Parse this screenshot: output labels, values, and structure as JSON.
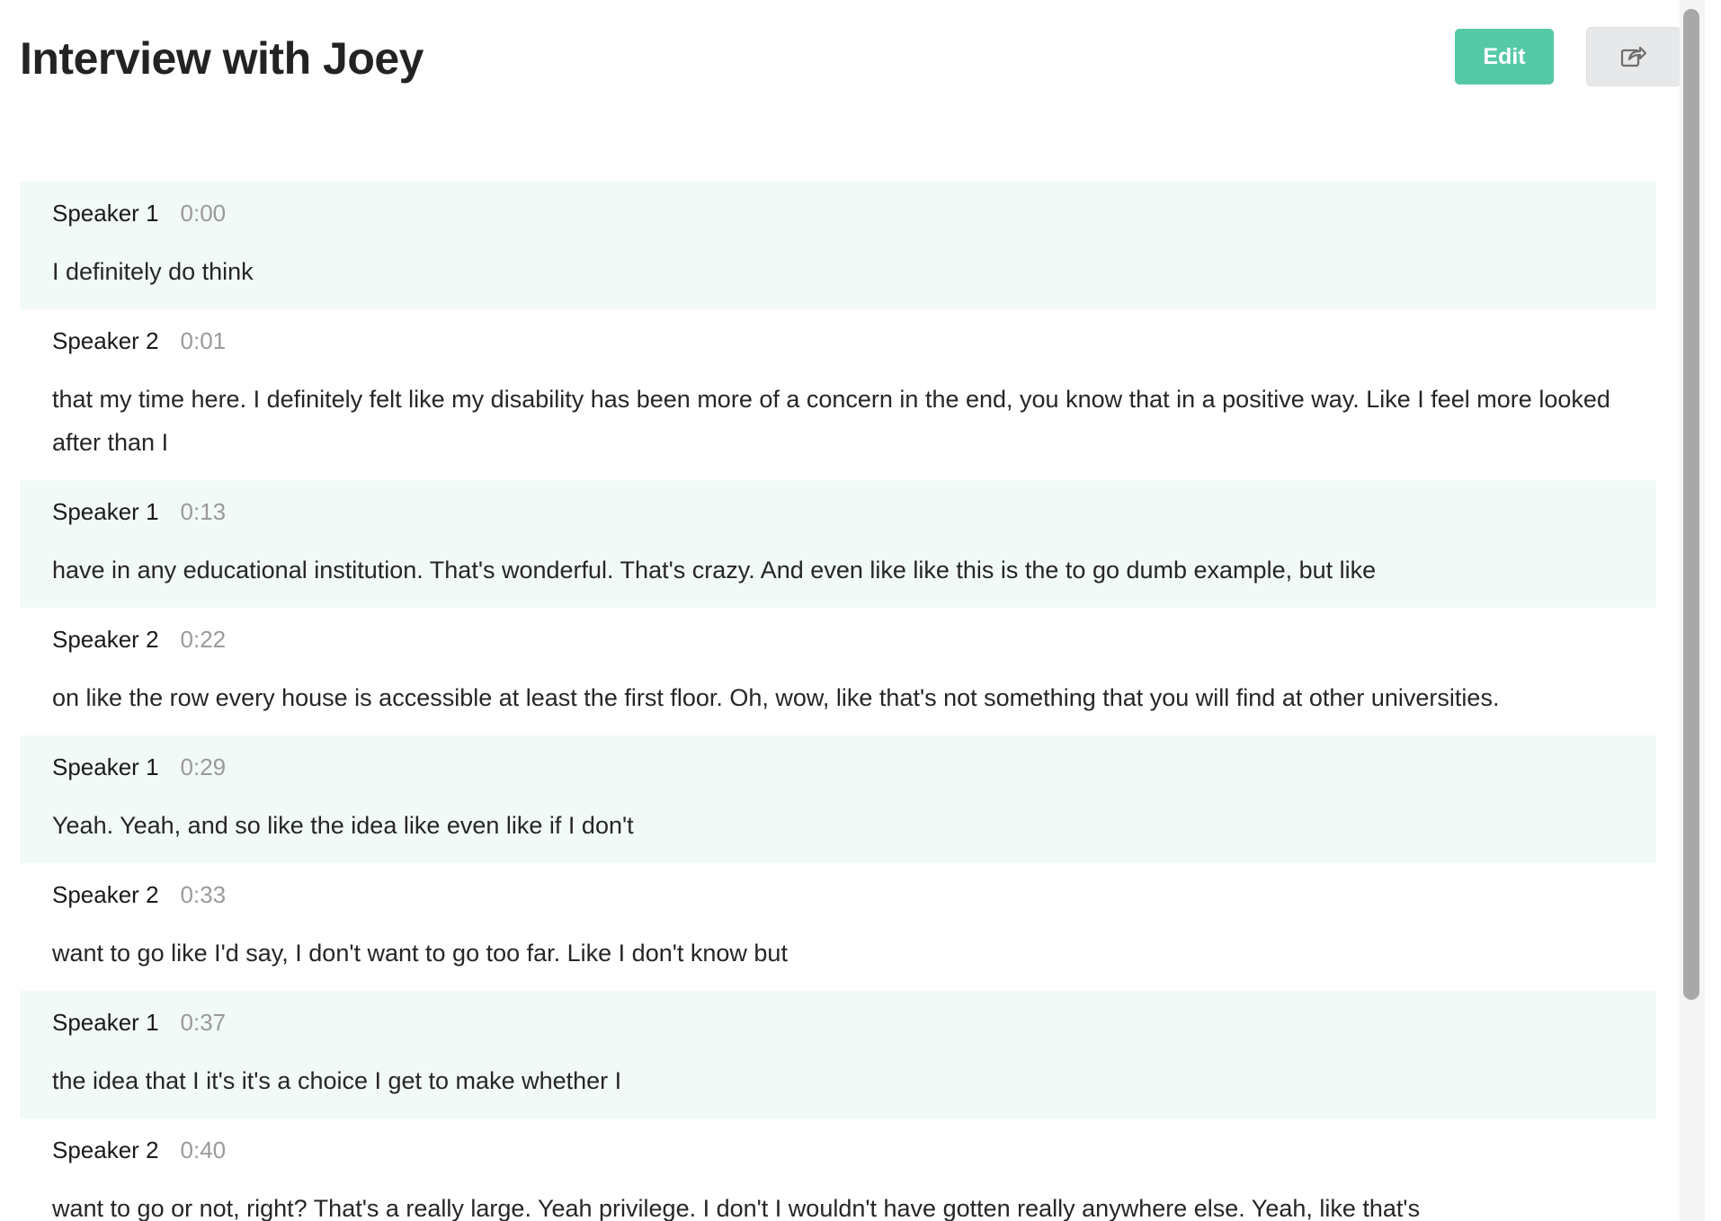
{
  "header": {
    "title": "Interview with Joey",
    "edit_label": "Edit",
    "share_icon": "share-icon"
  },
  "colors": {
    "accent": "#55c9a6",
    "shaded_row": "#f2faf7",
    "timestamp": "#9a9a9a"
  },
  "transcript": {
    "segments": [
      {
        "speaker": "Speaker 1",
        "time": "0:00",
        "text": "I definitely do think"
      },
      {
        "speaker": "Speaker 2",
        "time": "0:01",
        "text": "that my time here. I definitely felt like my disability has been more of a concern in the end, you know that in a positive way. Like I feel more looked after than I"
      },
      {
        "speaker": "Speaker 1",
        "time": "0:13",
        "text": "have in any educational institution. That's wonderful. That's crazy. And even like like this is the to go dumb example, but like"
      },
      {
        "speaker": "Speaker 2",
        "time": "0:22",
        "text": "on like the row every house is accessible at least the first floor. Oh, wow, like that's not something that you will find at other universities."
      },
      {
        "speaker": "Speaker 1",
        "time": "0:29",
        "text": "Yeah. Yeah, and so like the idea like even like if I don't"
      },
      {
        "speaker": "Speaker 2",
        "time": "0:33",
        "text": "want to go like I'd say, I don't want to go too far. Like I don't know but"
      },
      {
        "speaker": "Speaker 1",
        "time": "0:37",
        "text": "the idea that I it's it's a choice I get to make whether I"
      },
      {
        "speaker": "Speaker 2",
        "time": "0:40",
        "text": "want to go or not, right? That's a really large. Yeah privilege. I don't I wouldn't have gotten really anywhere else. Yeah, like that's"
      }
    ]
  }
}
